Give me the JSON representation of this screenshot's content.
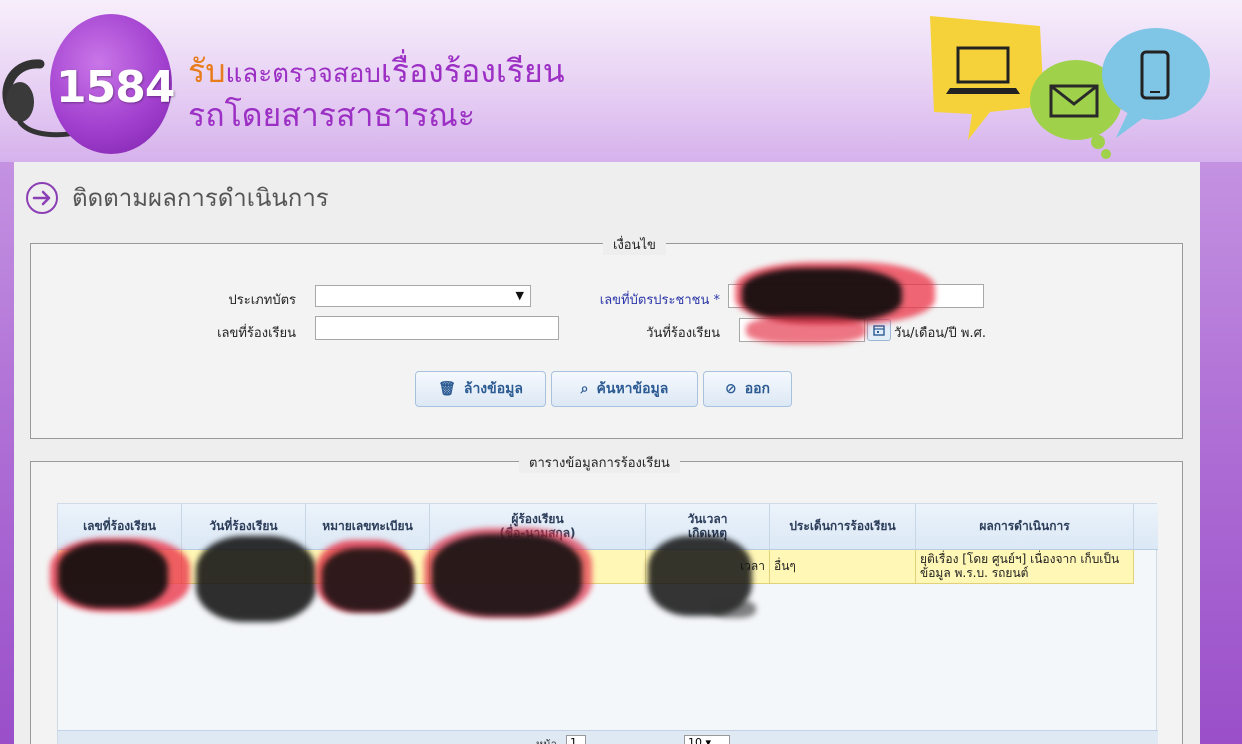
{
  "header": {
    "logo_number": "1584",
    "title_line1_part1": "รับ",
    "title_line1_part2": "และตรวจสอบ",
    "title_line1_part3": "เรื่องร้องเรียน",
    "title_line2": "รถโดยสารสาธารณะ",
    "illustration_icons": [
      "laptop-icon",
      "mail-icon",
      "mobile-phone-icon"
    ]
  },
  "page": {
    "title": "ติดตามผลการดำเนินการ"
  },
  "conditions": {
    "legend": "เงื่อนไข",
    "card_type_label": "ประเภทบัตร",
    "card_type_value": "",
    "citizen_id_label": "เลขที่บัตรประชาชน",
    "required_mark": "*",
    "complaint_no_label": "เลขที่ร้องเรียน",
    "complaint_no_value": "",
    "complaint_date_label": "วันที่ร้องเรียน",
    "date_hint": "วัน/เดือน/ปี พ.ศ.",
    "buttons": {
      "clear": "ล้างข้อมูล",
      "search": "ค้นหาข้อมูล",
      "exit": "ออก"
    }
  },
  "results": {
    "legend": "ตารางข้อมูลการร้องเรียน",
    "columns": [
      "เลขที่ร้องเรียน",
      "วันที่ร้องเรียน",
      "หมายเลขทะเบียน",
      "ผู้ร้องเรียน",
      "(ชื่อ-นามสกุล)",
      "วันเวลา",
      "เกิดเหตุ",
      "ประเด็นการร้องเรียน",
      "ผลการดำเนินการ"
    ],
    "rows": [
      {
        "issue": "อื่นๆ",
        "result": "ยุติเรื่อง [โดย ศูนย์ฯ] เนื่องจาก เก็บเป็นข้อมูล พ.ร.บ. รถยนต์",
        "time_fragment": "เวลา"
      }
    ],
    "pager": {
      "page_label": "หน้า",
      "page_value": "1",
      "rows_value": "10"
    }
  },
  "colors": {
    "brand_purple": "#9c2fc4",
    "brand_orange": "#e87c1a",
    "row_highlight": "#fff7b5",
    "link_blue": "#2d38a8"
  }
}
